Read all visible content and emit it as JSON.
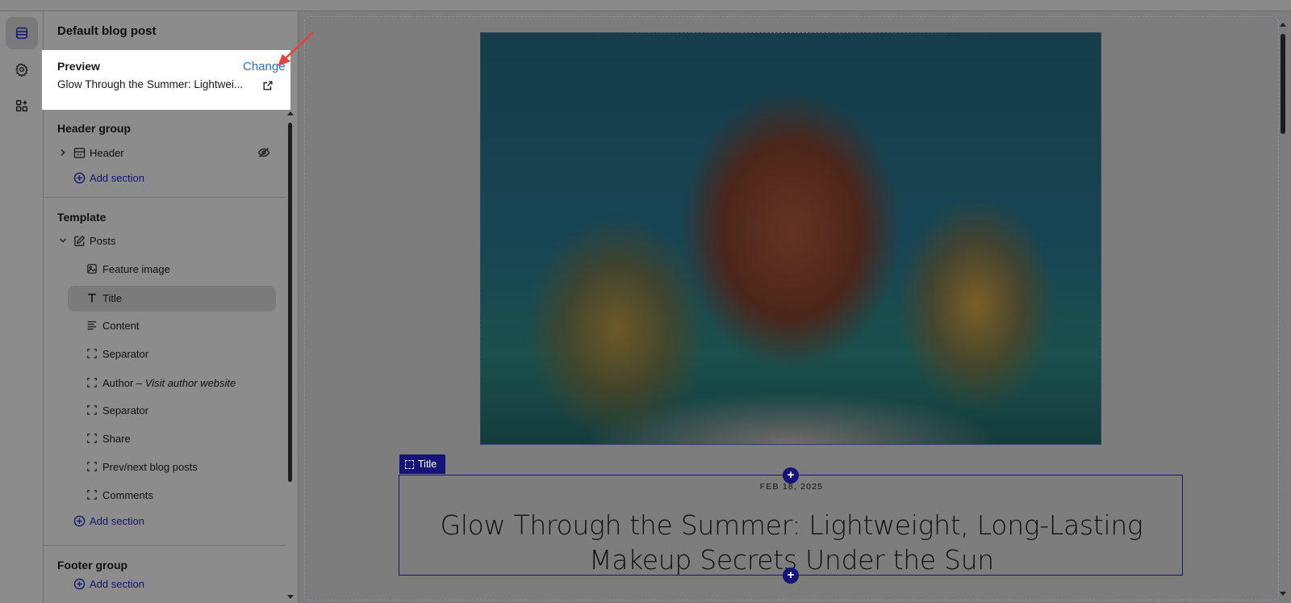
{
  "sidebar": {
    "title": "Default blog post",
    "preview": {
      "label": "Preview",
      "change_label": "Change",
      "post_name": "Glow Through the Summer: Lightwei..."
    },
    "header_group": {
      "heading": "Header group",
      "items": [
        {
          "label": "Header"
        }
      ],
      "add_section": "Add section"
    },
    "template": {
      "heading": "Template",
      "parent": "Posts",
      "items": [
        {
          "label": "Feature image",
          "icon": "image-icon"
        },
        {
          "label": "Title",
          "icon": "text-icon"
        },
        {
          "label": "Content",
          "icon": "paragraph-icon"
        },
        {
          "label": "Separator",
          "icon": "block-icon"
        },
        {
          "label": "Author – ",
          "italic": "Visit author website",
          "icon": "block-icon"
        },
        {
          "label": "Separator",
          "icon": "block-icon"
        },
        {
          "label": "Share",
          "icon": "block-icon"
        },
        {
          "label": "Prev/next blog posts",
          "icon": "block-icon"
        },
        {
          "label": "Comments",
          "icon": "block-icon"
        }
      ],
      "add_section": "Add section"
    },
    "footer_group": {
      "heading": "Footer group",
      "add_section": "Add section"
    }
  },
  "preview_canvas": {
    "title_tag": "Title",
    "post_date": "FEB 18, 2025",
    "post_title": "Glow Through the Summer: Lightweight, Long-Lasting Makeup Secrets Under the Sun"
  },
  "colors": {
    "accent": "#2c6ecb",
    "selection": "#13137a",
    "annotation_arrow": "#e8403a"
  }
}
